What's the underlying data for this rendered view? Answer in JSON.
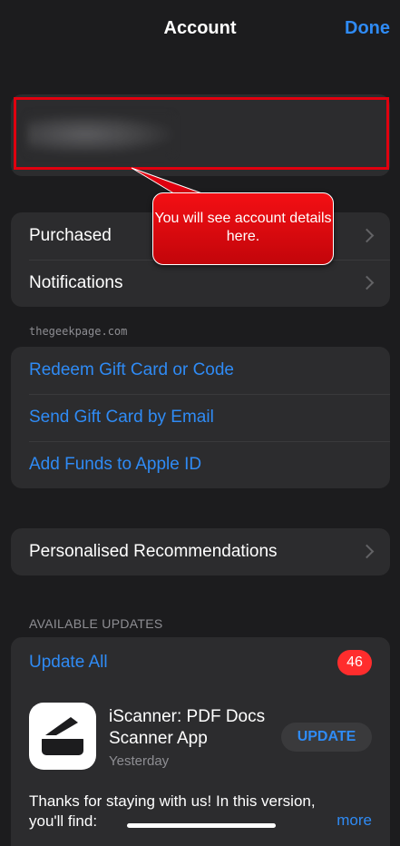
{
  "nav": {
    "title": "Account",
    "done_label": "Done"
  },
  "callout": {
    "text": "You will see account details here."
  },
  "menu1": [
    {
      "label": "Purchased"
    },
    {
      "label": "Notifications"
    }
  ],
  "watermark": "thegeekpage.com",
  "menu2": [
    {
      "label": "Redeem Gift Card or Code"
    },
    {
      "label": "Send Gift Card by Email"
    },
    {
      "label": "Add Funds to Apple ID"
    }
  ],
  "menu3": [
    {
      "label": "Personalised Recommendations"
    }
  ],
  "updates": {
    "header": "AVAILABLE UPDATES",
    "update_all_label": "Update All",
    "badge_count": "46",
    "app": {
      "name": "iScanner: PDF Docs Scanner App",
      "date": "Yesterday",
      "button_label": "UPDATE",
      "icon": "scanner-icon",
      "notes": "Thanks for staying with us! In this version, you'll find:",
      "more_label": "more"
    }
  },
  "colors": {
    "accent": "#2f8bf5",
    "annotation_red": "#e0000f",
    "badge_red": "#ff2d2d"
  }
}
